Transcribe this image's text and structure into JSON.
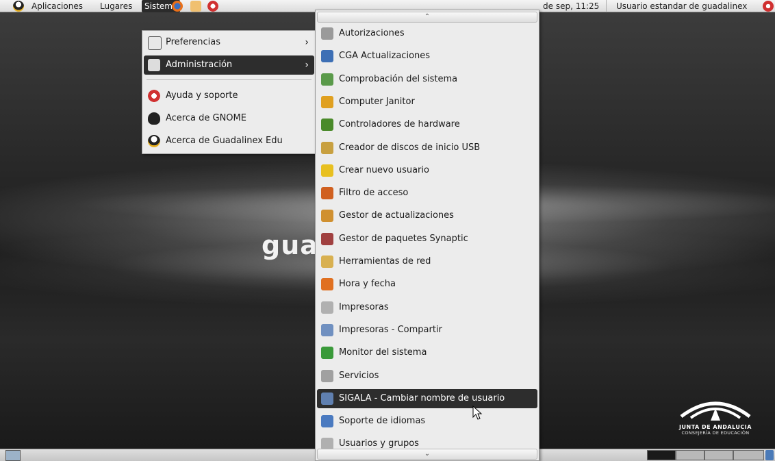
{
  "top_panel": {
    "applications": "Aplicaciones",
    "places": "Lugares",
    "system": "Sistema",
    "clock": "de sep, 11:25",
    "user": "Usuario estandar de guadalinex"
  },
  "system_menu": {
    "items": [
      {
        "label": "Preferencias",
        "icon": "preferences-icon",
        "submenu": true
      },
      {
        "label": "Administración",
        "icon": "tools-icon",
        "submenu": true,
        "selected": true
      },
      {
        "label": "Ayuda y soporte",
        "icon": "lifebuoy-icon"
      },
      {
        "label": "Acerca de GNOME",
        "icon": "gnome-foot-icon"
      },
      {
        "label": "Acerca de Guadalinex Edu",
        "icon": "penguin-icon"
      }
    ]
  },
  "admin_menu": {
    "items": [
      {
        "label": "Autorizaciones",
        "icon": "keys-icon",
        "color": "#9a9a9a"
      },
      {
        "label": "CGA Actualizaciones",
        "icon": "satellite-icon",
        "color": "#3d6fb5"
      },
      {
        "label": "Comprobación del sistema",
        "icon": "monitor-check-icon",
        "color": "#5a9a4a"
      },
      {
        "label": "Computer Janitor",
        "icon": "broom-icon",
        "color": "#e0a020"
      },
      {
        "label": "Controladores de hardware",
        "icon": "hardware-card-icon",
        "color": "#4a8a2a"
      },
      {
        "label": "Creador de discos de inicio USB",
        "icon": "usb-disk-icon",
        "color": "#c8a040"
      },
      {
        "label": "Crear nuevo usuario",
        "icon": "smiley-add-icon",
        "color": "#e8c020"
      },
      {
        "label": "Filtro de acceso",
        "icon": "filter-icon",
        "color": "#d06020"
      },
      {
        "label": "Gestor de actualizaciones",
        "icon": "update-manager-icon",
        "color": "#d09030"
      },
      {
        "label": "Gestor de paquetes Synaptic",
        "icon": "synaptic-icon",
        "color": "#a04040"
      },
      {
        "label": "Herramientas de red",
        "icon": "network-tools-icon",
        "color": "#d8b050"
      },
      {
        "label": "Hora y fecha",
        "icon": "clock-icon",
        "color": "#e07020"
      },
      {
        "label": "Impresoras",
        "icon": "printer-icon",
        "color": "#b0b0b0"
      },
      {
        "label": "Impresoras - Compartir",
        "icon": "printer-share-icon",
        "color": "#7090c0"
      },
      {
        "label": "Monitor del sistema",
        "icon": "system-monitor-icon",
        "color": "#3a9a3a"
      },
      {
        "label": "Servicios",
        "icon": "services-icon",
        "color": "#a0a0a0"
      },
      {
        "label": "SIGALA - Cambiar nombre de usuario",
        "icon": "users-rename-icon",
        "color": "#6080b0",
        "selected": true
      },
      {
        "label": "Soporte de idiomas",
        "icon": "language-icon",
        "color": "#4a7ac0"
      },
      {
        "label": "Usuarios y grupos",
        "icon": "users-groups-icon",
        "color": "#b0b0b0"
      }
    ]
  },
  "desktop": {
    "logo_text": "guadalinex",
    "junta_title": "JUNTA DE ANDALUCIA",
    "junta_subtitle": "CONSEJERÍA DE EDUCACIÓN"
  },
  "colors": {
    "selection": "#2d2d2d",
    "menu_bg": "#ececec"
  }
}
